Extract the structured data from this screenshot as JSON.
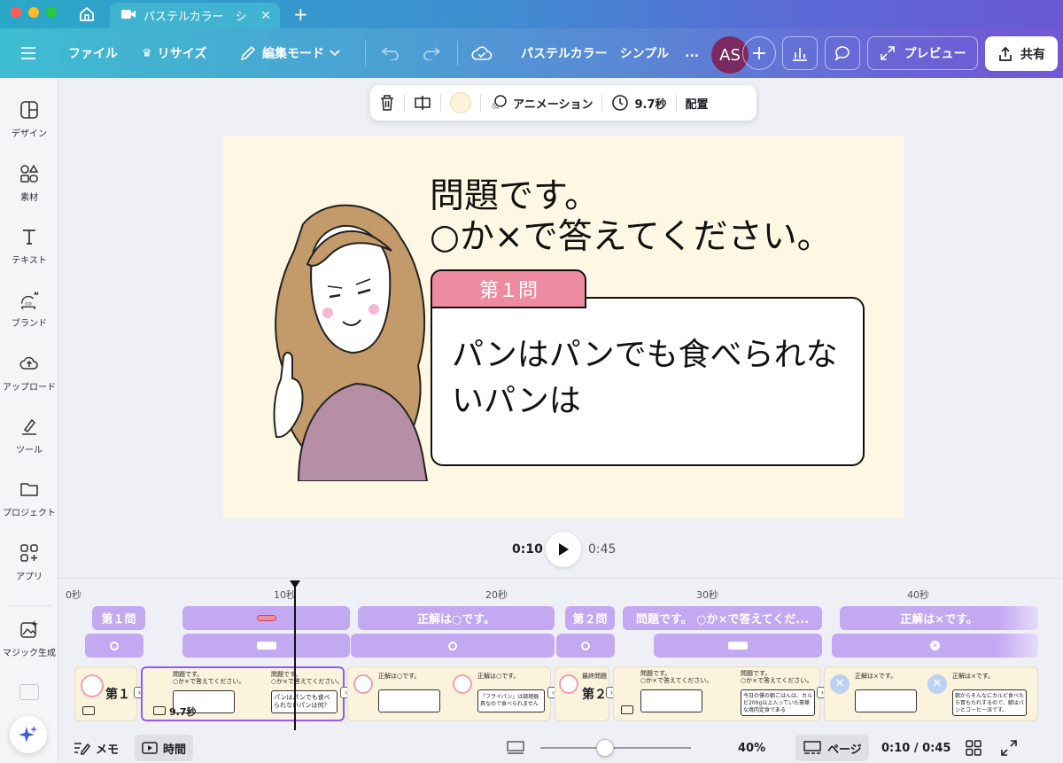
{
  "browser": {
    "tab_title": "パステルカラー　シ",
    "home_icon": "home-icon",
    "new_tab_icon": "plus-icon",
    "traffic_colors": [
      "#ff5f57",
      "#febc2e",
      "#28c840"
    ]
  },
  "toolbar": {
    "file_label": "ファイル",
    "resize_label": "リサイズ",
    "edit_mode_label": "編集モード",
    "doc_title": "パステルカラー　シンプル",
    "more_label": "...",
    "avatar_initials": "AS",
    "preview_label": "プレビュー",
    "share_label": "共有"
  },
  "sidebar": {
    "items": [
      {
        "label": "デザイン",
        "icon": "design-icon"
      },
      {
        "label": "素材",
        "icon": "elements-icon"
      },
      {
        "label": "テキスト",
        "icon": "text-icon"
      },
      {
        "label": "ブランド",
        "icon": "brand-icon"
      },
      {
        "label": "アップロード",
        "icon": "upload-icon"
      },
      {
        "label": "ツール",
        "icon": "tools-icon"
      },
      {
        "label": "プロジェクト",
        "icon": "folder-icon"
      },
      {
        "label": "アプリ",
        "icon": "apps-icon"
      },
      {
        "label": "マジック生成",
        "icon": "magic-media-icon"
      }
    ]
  },
  "context_bar": {
    "animation_label": "アニメーション",
    "duration_label": "9.7秒",
    "position_label": "配置",
    "swatch_color": "#fdf3d6"
  },
  "slide": {
    "title_line1": "問題です。",
    "title_line2": "○か×で答えてください。",
    "badge": "第１問",
    "question": "パンはパンでも食べられないパンは",
    "background": "#fdf7e3",
    "badge_color": "#ee8ba0"
  },
  "playback": {
    "current": "0:10",
    "total": "0:45"
  },
  "timeline": {
    "ruler": [
      "0秒",
      "10秒",
      "20秒",
      "30秒",
      "40秒"
    ],
    "text_tracks": [
      "第１問",
      "正解は○です。",
      "第２問",
      "問題です。 ○か×で答えてくだ...",
      "正解は×です。"
    ],
    "selected_clip_duration": "9.7秒",
    "clip1_label": "第１",
    "clip5_label": "第２",
    "thumb_title1": "問題です。",
    "thumb_title2": "○か×で答えてください。",
    "thumb_question": "パンはパンでも食べられないパンは何？",
    "thumb_answer_o": "正解は○です。",
    "thumb_answer_x": "正解は×です。",
    "thumb_frypan": "「フライパン」は調理器具なので食べられません",
    "thumb_final": "最終問題",
    "thumb_q2": "今日の僕の朝ごはんは、カルビ200g以上入っていた豪華な焼肉定食である",
    "thumb_a2": "朝からそんなにカルビ食べたら胃もたれするので、朝はパンとコーヒー派です。",
    "track_color": "#c3a8f2"
  },
  "bottombar": {
    "memo_label": "メモ",
    "time_label": "時間",
    "zoom": "40%",
    "pages_label": "ページ",
    "time_display": "0:10 / 0:45"
  }
}
